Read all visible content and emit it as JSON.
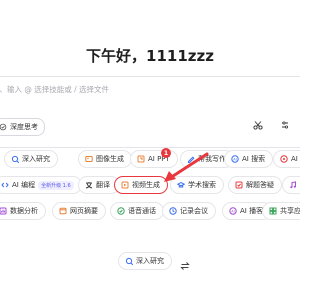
{
  "greeting": "下午好，1111zzz",
  "input": {
    "placeholder": "息、输入 @ 选择技能或 / 选择文件"
  },
  "deep_think": {
    "label": "深度思考"
  },
  "step_badge": "1",
  "chips": [
    {
      "label": "深入研究",
      "icon": "deep-research-icon",
      "color": "#3b6ef5",
      "badge": ""
    },
    {
      "label": "图像生成",
      "icon": "image-icon",
      "color": "#e8833a",
      "badge": ""
    },
    {
      "label": "AI PPT",
      "icon": "ppt-icon",
      "color": "#e8833a",
      "badge": ""
    },
    {
      "label": "帮我写作",
      "icon": "write-icon",
      "color": "#3b6ef5",
      "badge": ""
    },
    {
      "label": "AI 搜索",
      "icon": "search-icon",
      "color": "#3b6ef5",
      "badge": ""
    },
    {
      "label": "AI 阅",
      "icon": "read-icon",
      "color": "#e8383d",
      "badge": ""
    },
    {
      "label": "AI 编程",
      "icon": "code-icon",
      "color": "#3b6ef5",
      "badge": "全新升级 1.6"
    },
    {
      "label": "翻译",
      "icon": "translate-icon",
      "color": "#444",
      "badge": ""
    },
    {
      "label": "视频生成",
      "icon": "video-icon",
      "color": "#e8833a",
      "badge": ""
    },
    {
      "label": "学术搜索",
      "icon": "academic-icon",
      "color": "#3b6ef5",
      "badge": ""
    },
    {
      "label": "解题答疑",
      "icon": "solve-icon",
      "color": "#e8383d",
      "badge": ""
    },
    {
      "label": "音",
      "icon": "music-icon",
      "color": "#a24bd6",
      "badge": ""
    },
    {
      "label": "数据分析",
      "icon": "data-icon",
      "color": "#a24bd6",
      "badge": ""
    },
    {
      "label": "网页摘要",
      "icon": "webpage-icon",
      "color": "#e8833a",
      "badge": ""
    },
    {
      "label": "语音通话",
      "icon": "phone-icon",
      "color": "#3ba55c",
      "badge": ""
    },
    {
      "label": "记录会议",
      "icon": "meeting-icon",
      "color": "#3b6ef5",
      "badge": ""
    },
    {
      "label": "AI 播客",
      "icon": "podcast-icon",
      "color": "#a24bd6",
      "badge": ""
    },
    {
      "label": "共享应用",
      "icon": "share-icon",
      "color": "#3ba55c",
      "badge": ""
    },
    {
      "label": "深入研究",
      "icon": "deep-research-icon",
      "color": "#3b6ef5",
      "badge": ""
    }
  ],
  "selected_chip": "视频生成",
  "annotation_color": "#e8383d"
}
